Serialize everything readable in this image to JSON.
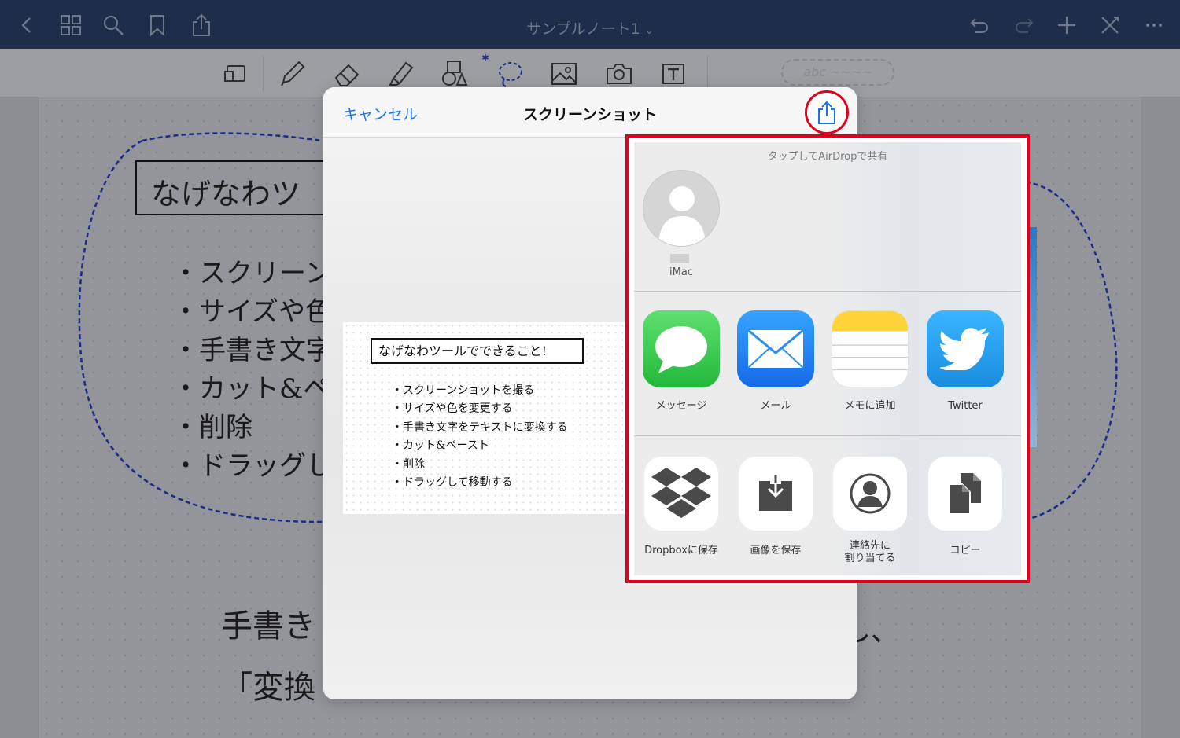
{
  "topbar": {
    "title": "サンプルノート1",
    "title_caret": "⌄",
    "left_icons": [
      "back-icon",
      "grid-icon",
      "search-icon",
      "bookmark-icon",
      "share-icon"
    ],
    "right_icons": [
      "undo-icon",
      "redo-icon",
      "add-icon",
      "close-icon",
      "more-icon"
    ]
  },
  "toolbar": {
    "tools": [
      "page-layout-icon",
      "pen-icon",
      "eraser-icon",
      "highlighter-icon",
      "shapes-icon",
      "lasso-icon",
      "image-icon",
      "camera-icon",
      "text-icon"
    ],
    "bluetooth_badge": "✱",
    "pen_preview": "abc ~~~~"
  },
  "note": {
    "title_fragment": "なげなわツ",
    "bullets": [
      "・スクリーンシ",
      "・サイズや色",
      "・手書き文字",
      "・カット&ペ",
      "・削除",
      "・ドラッグし"
    ],
    "bottom_line1": "手書き",
    "bottom_line1_end": "し、",
    "bottom_line2": "「変換"
  },
  "modal": {
    "cancel_label": "キャンセル",
    "title": "スクリーンショット",
    "preview": {
      "title": "なげなわツールでできること!",
      "items": [
        "スクリーンショットを撮る",
        "サイズや色を変更する",
        "手書き文字をテキストに変換する",
        "カット&ペースト",
        "削除",
        "ドラッグして移動する"
      ]
    }
  },
  "share_sheet": {
    "airdrop_label": "タップしてAirDropで共有",
    "device_name": "iMac",
    "apps": [
      {
        "label": "メッセージ",
        "icon": "messages-icon",
        "color": "#33c94a"
      },
      {
        "label": "メール",
        "icon": "mail-icon",
        "color": "#2b8ef5"
      },
      {
        "label": "メモに追加",
        "icon": "notes-icon",
        "color": "#ffd43b"
      },
      {
        "label": "Twitter",
        "icon": "twitter-icon",
        "color": "#1da1f2"
      }
    ],
    "actions": [
      {
        "label": "Dropboxに保存",
        "icon": "dropbox-icon"
      },
      {
        "label": "画像を保存",
        "icon": "save-image-icon"
      },
      {
        "label": "連絡先に\n割り当てる",
        "icon": "assign-contact-icon"
      },
      {
        "label": "コピー",
        "icon": "copy-icon"
      }
    ]
  },
  "colors": {
    "highlight": "#e0001a",
    "accent": "#1a73e8",
    "topbar": "#1e2d49",
    "lasso": "#1b2c8c"
  }
}
